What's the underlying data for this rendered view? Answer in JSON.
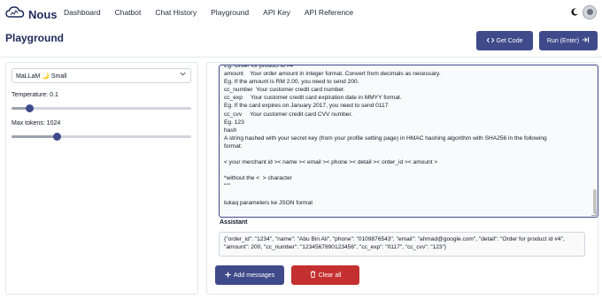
{
  "app": {
    "name": "Nous"
  },
  "nav": {
    "links": [
      "Dashboard",
      "Chatbot",
      "Chat History",
      "Playground",
      "API Key",
      "API Reference"
    ]
  },
  "page": {
    "title": "Playground"
  },
  "actions": {
    "get_code": "Get Code",
    "run": "Run (Enter)"
  },
  "settings": {
    "model": "MaLLaM 🌙 Small",
    "temperature": {
      "label": "Temperature: 0.1",
      "value": 0.1,
      "max": 1
    },
    "max_tokens": {
      "label": "Max tokens: 1024",
      "value": 1024,
      "max": 4096
    }
  },
  "prompt": {
    "lines": [
      "Eg. Order for product id #4",
      "amount    Your order amount in integer format. Convert from decimals as necessary.",
      "Eg. If the amount is RM 2.00, you need to send 200.",
      "cc_number  Your customer credit card number.",
      "cc_exp     Your customer credit card expiration date in MMYY format.",
      "Eg. If the card expires on January 2017, you need to send 0117",
      "cc_cvv     Your customer credit card CVV number.",
      "Eg. 123",
      "hash",
      "A string hashed with your secret key (from your profile setting page) in HMAC hashing algorithm with SHA256 in the following",
      "format:",
      "",
      "< your merchant id >< name >< email >< phone >< detail >< order_id >< amount >",
      "",
      "*without the <  > character",
      "\"\"\"",
      "",
      "tukaq parameters ke JSON format"
    ]
  },
  "assistant": {
    "label": "Assistant",
    "text": "{\"order_id\": \"1234\", \"name\": \"Abu Bin Ali\", \"phone\": \"0109876543\", \"email\": \"ahmad@google.com\", \"detail\": \"Order for product id #4\", \"amount\": 200, \"cc_number\": \"1234567890123456\", \"cc_exp\": \"0117\", \"cc_cvv\": \"123\"}"
  },
  "buttons": {
    "add_messages": "Add messages",
    "clear_all": "Clear all"
  },
  "colors": {
    "primary": "#3f4a8a",
    "danger": "#c43030",
    "brand": "#1e2a5a"
  },
  "icons": [
    "cloud-logo-icon",
    "moon-icon",
    "code-icon",
    "enter-icon",
    "plus-icon",
    "trash-icon",
    "chevron-down-icon"
  ]
}
